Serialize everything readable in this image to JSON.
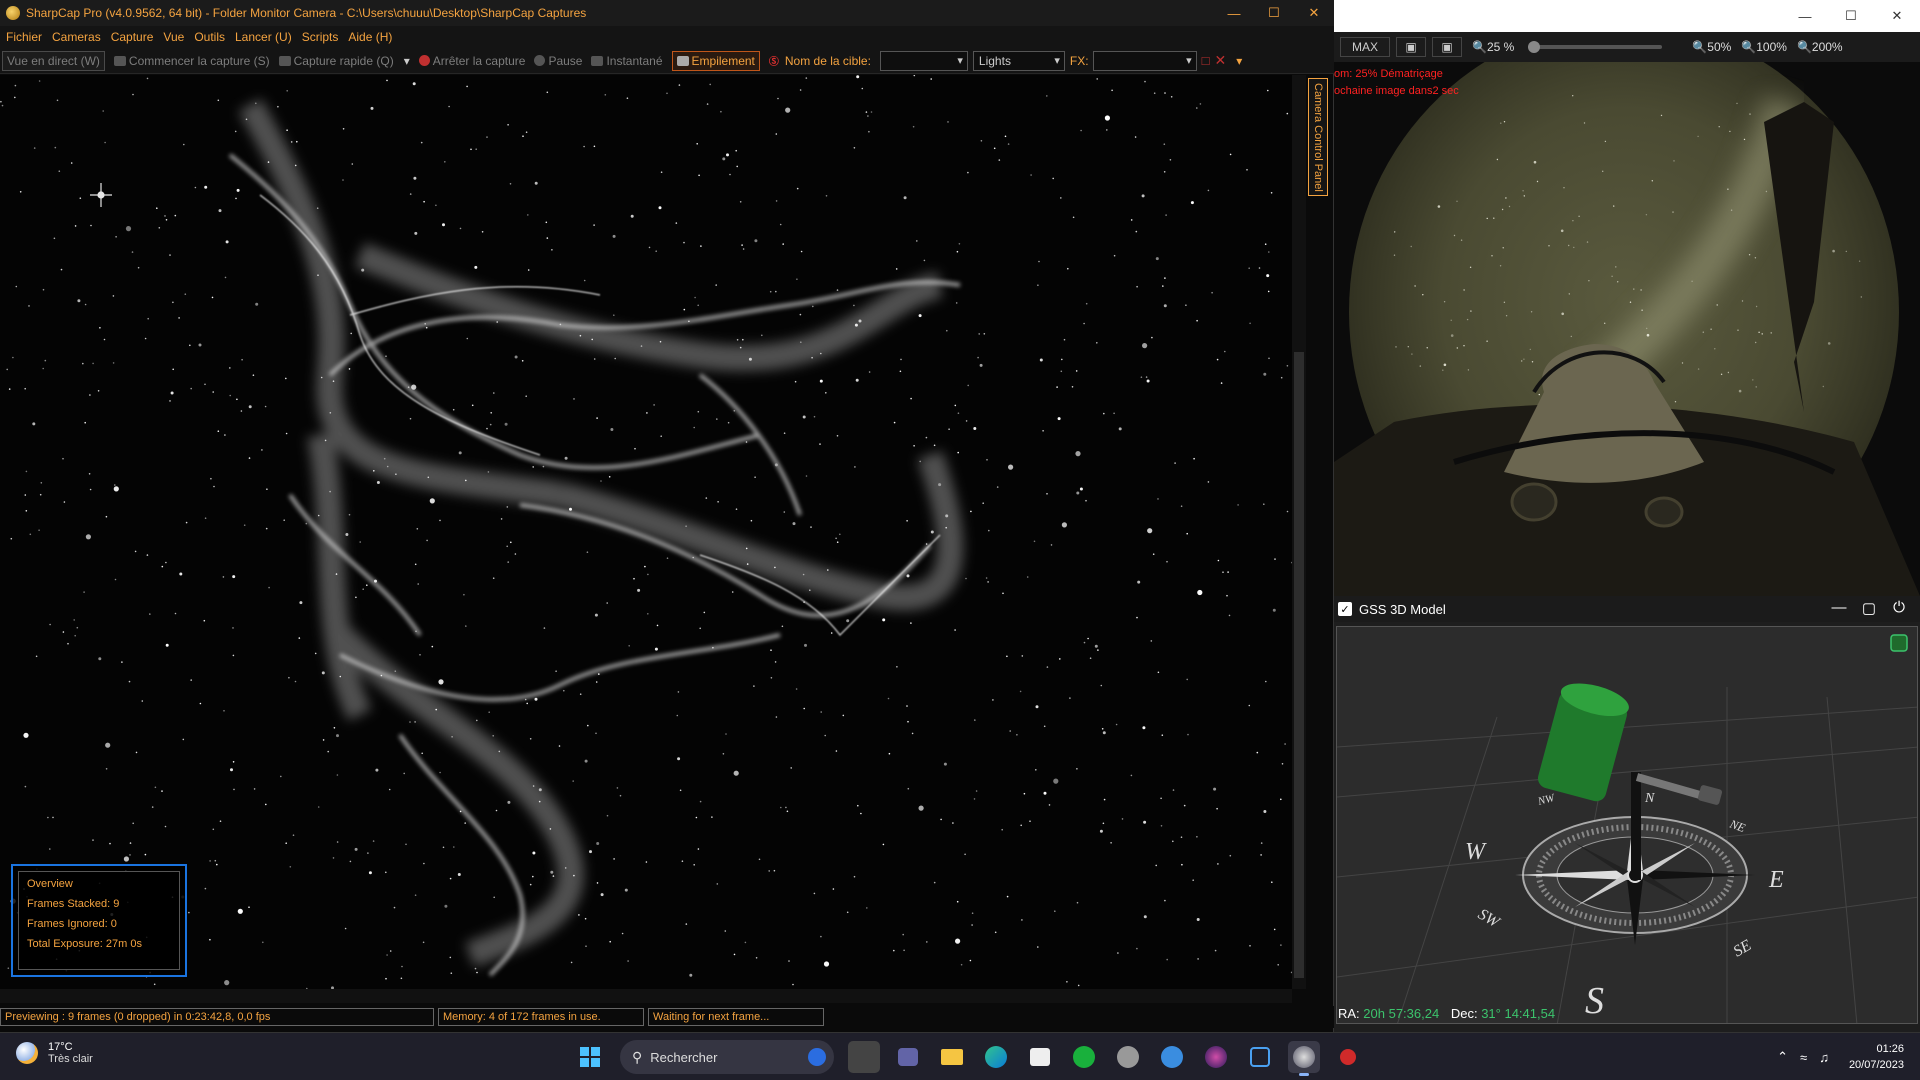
{
  "sharpcap": {
    "title": "SharpCap Pro (v4.0.9562, 64 bit) - Folder Monitor Camera - C:\\Users\\chuuu\\Desktop\\SharpCap Captures",
    "menu": [
      "Fichier",
      "Cameras",
      "Capture",
      "Vue",
      "Outils",
      "Lancer (U)",
      "Scripts",
      "Aide (H)"
    ],
    "toolbar": {
      "live_view": "Vue en direct (W)",
      "start_capture": "Commencer la capture (S)",
      "quick_capture": "Capture rapide (Q)",
      "stop_capture": "Arrêter la capture",
      "pause": "Pause",
      "snapshot": "Instantané",
      "stacking": "Empilement",
      "target_label": "Nom de la cible:",
      "target_value": "",
      "frame_type": "Lights",
      "fx_label": "FX:",
      "fx_value": ""
    },
    "side_tab": "Camera Control Panel",
    "overview": {
      "title": "Overview",
      "frames_stacked": "Frames Stacked: 9",
      "frames_ignored": "Frames Ignored: 0",
      "total_exposure": "Total Exposure:   27m 0s"
    },
    "status": {
      "preview": "Previewing : 9 frames (0 dropped) in 0:23:42,8, 0,0 fps",
      "memory": "Memory: 4 of 172 frames in use.",
      "waiting": "Waiting for next frame..."
    }
  },
  "allsky": {
    "toolbar": {
      "max": "MAX",
      "zoom_current": "25 %",
      "zoom_50": "50%",
      "zoom_100": "100%",
      "zoom_200": "200%"
    },
    "overlay_line1": "om: 25%   Dématriçage",
    "overlay_line2": "ochaine image dans2 sec"
  },
  "gss": {
    "title": "GSS 3D Model",
    "checked": true,
    "ra_label": "RA:",
    "ra_value": "20h 57:36,24",
    "dec_label": "Dec:",
    "dec_value": "31° 14:41,54",
    "compass": {
      "n": "N",
      "ne": "NE",
      "e": "E",
      "se": "SE",
      "s": "S",
      "sw": "SW",
      "w": "W",
      "nw": "NW"
    }
  },
  "taskbar": {
    "temperature": "17°C",
    "weather": "Très clair",
    "search_placeholder": "Rechercher",
    "time": "01:26",
    "date": "20/07/2023"
  },
  "colors": {
    "accent": "#f4a340",
    "overview_border": "#1a74e0",
    "gss_green": "#3cc36c",
    "alert_red": "#ff2222"
  }
}
